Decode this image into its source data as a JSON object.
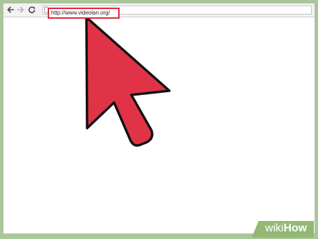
{
  "browser": {
    "url": "http://www.videolan.org/"
  },
  "logo": {
    "part1": "wiki",
    "part2": "How"
  },
  "colors": {
    "frame": "#a8c896",
    "pointer_fill": "#e03348",
    "highlight": "#e0243a"
  },
  "icons": {
    "back": "back-arrow-icon",
    "forward": "forward-arrow-icon",
    "reload": "reload-icon",
    "page": "page-icon",
    "pointer": "mouse-pointer-icon"
  }
}
